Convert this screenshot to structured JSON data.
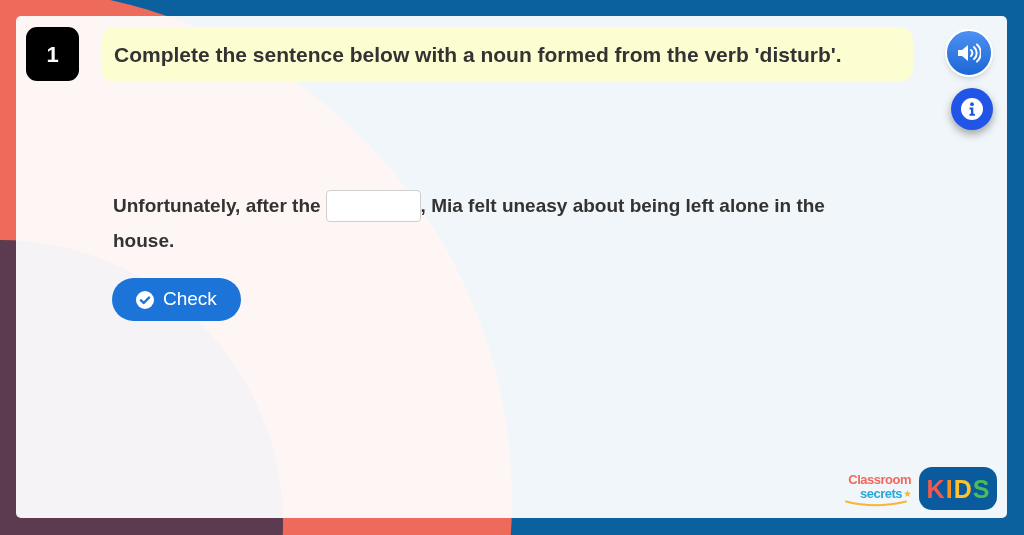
{
  "question": {
    "number": "1",
    "prompt": "Complete the sentence below with a noun formed from the verb 'disturb'."
  },
  "sentence": {
    "before": "Unfortunately, after the",
    "after_lines": [
      ", Mia felt uneasy about being left alone in the",
      "house."
    ]
  },
  "check_button": {
    "label": "Check"
  },
  "branding": {
    "lines": [
      "Classroom",
      "secrets"
    ],
    "badge": "KIDS"
  }
}
